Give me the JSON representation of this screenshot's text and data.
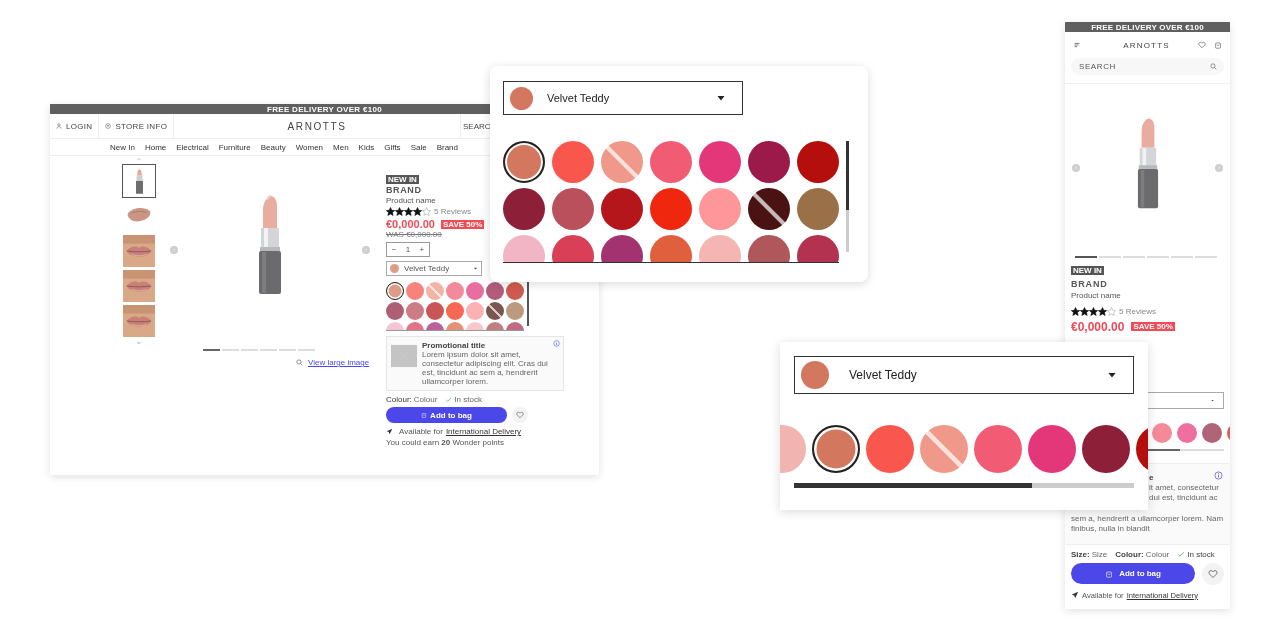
{
  "desktop": {
    "banner": "FREE DELIVERY OVER €100",
    "header": {
      "login": "LOGIN",
      "store_info": "STORE INFO",
      "logo": "ARNOTTS",
      "search": "SEARC"
    },
    "nav": [
      "New In",
      "Home",
      "Electrical",
      "Furniture",
      "Beauty",
      "Women",
      "Men",
      "Kids",
      "Gifts",
      "Sale",
      "Brand"
    ],
    "thumbnails": [
      {
        "kind": "product",
        "selected": true
      },
      {
        "kind": "smear",
        "selected": false
      },
      {
        "kind": "lips",
        "selected": false
      },
      {
        "kind": "lips",
        "selected": false
      },
      {
        "kind": "lips",
        "selected": false
      }
    ],
    "slides": [
      {
        "selected": true
      },
      {
        "selected": false
      },
      {
        "selected": false
      },
      {
        "selected": false
      },
      {
        "selected": false
      },
      {
        "selected": false
      }
    ],
    "view_large_image": "View large image",
    "product": {
      "tag": "NEW IN",
      "brand": "BRAND",
      "name": "Product name",
      "stars": 4,
      "reviews": "5 Reviews",
      "price": "€0,000.00",
      "save_badge": "SAVE 50%",
      "was_price": "WAS €0,000.00",
      "quantity": {
        "minus": "−",
        "value": "1",
        "plus": "+"
      },
      "shade_select": {
        "value": "Velvet Teddy",
        "color": "#dd9c88"
      },
      "swatches": [
        {
          "color": "#dd9c88",
          "kind": "solid",
          "selected": true
        },
        {
          "color": "#f8837a",
          "kind": "solid",
          "selected": false
        },
        {
          "color": "#f3b4a5",
          "kind": "split",
          "selected": false
        },
        {
          "color": "#f3899a",
          "kind": "solid",
          "selected": false
        },
        {
          "color": "#e96ea0",
          "kind": "solid",
          "selected": false
        },
        {
          "color": "#b15c7d",
          "kind": "solid",
          "selected": false
        },
        {
          "color": "#ce5a50",
          "kind": "solid",
          "selected": false
        },
        {
          "color": "#ad5f74",
          "kind": "solid",
          "selected": false
        },
        {
          "color": "#cd7c85",
          "kind": "solid",
          "selected": false
        },
        {
          "color": "#c95656",
          "kind": "solid",
          "selected": false
        },
        {
          "color": "#f76852",
          "kind": "solid",
          "selected": false
        },
        {
          "color": "#fcb2b3",
          "kind": "solid",
          "selected": false
        },
        {
          "color": "#7b564f",
          "kind": "split",
          "selected": false
        },
        {
          "color": "#bb9a80",
          "kind": "solid",
          "selected": false
        },
        {
          "color": "#f4c4d2",
          "kind": "solid",
          "selected": false
        },
        {
          "color": "#e07386",
          "kind": "solid",
          "selected": false
        },
        {
          "color": "#b96298",
          "kind": "solid",
          "selected": false
        },
        {
          "color": "#e69176",
          "kind": "solid",
          "selected": false
        },
        {
          "color": "#f8c7c9",
          "kind": "solid",
          "selected": false
        },
        {
          "color": "#c08080",
          "kind": "solid",
          "selected": false
        },
        {
          "color": "#c06b83",
          "kind": "solid",
          "selected": false
        }
      ],
      "promo": {
        "title": "Promotional title",
        "text": "Lorem ipsum dolor sit amet, consectetur adipiscing elit. Cras dui est, tincidunt ac sem a, hendrerit ullamcorper lorem."
      },
      "colour_label": "Colour:",
      "colour_value": "Colour",
      "stock": "In stock",
      "add_to_bag": "Add to bag",
      "delivery_prefix": "Available for",
      "delivery_link": "International Delivery",
      "points": "You could earn **20** Wonder points"
    }
  },
  "popup": {
    "shade_select": {
      "value": "Velvet Teddy",
      "color": "#d4775f"
    },
    "swatches": [
      {
        "color": "#d4775f",
        "kind": "solid",
        "selected": true
      },
      {
        "color": "#f9574e",
        "kind": "solid",
        "selected": false
      },
      {
        "color": "#f0998a",
        "kind": "split",
        "selected": false
      },
      {
        "color": "#f25b74",
        "kind": "solid",
        "selected": false
      },
      {
        "color": "#e3377a",
        "kind": "solid",
        "selected": false
      },
      {
        "color": "#9b1a4a",
        "kind": "solid",
        "selected": false
      },
      {
        "color": "#b40f0c",
        "kind": "solid",
        "selected": false
      },
      {
        "color": "#8e1f38",
        "kind": "solid",
        "selected": false
      },
      {
        "color": "#b9505c",
        "kind": "solid",
        "selected": false
      },
      {
        "color": "#b5161c",
        "kind": "solid",
        "selected": false
      },
      {
        "color": "#f0270f",
        "kind": "solid",
        "selected": false
      },
      {
        "color": "#fe979a",
        "kind": "solid",
        "selected": false
      },
      {
        "color": "#4a1212",
        "kind": "split",
        "selected": false
      },
      {
        "color": "#9a7048",
        "kind": "solid",
        "selected": false
      },
      {
        "color": "#f2b5c6",
        "kind": "solid",
        "selected": false
      },
      {
        "color": "#d93f57",
        "kind": "solid",
        "selected": false
      },
      {
        "color": "#a23270",
        "kind": "solid",
        "selected": false
      },
      {
        "color": "#e0603d",
        "kind": "solid",
        "selected": false
      },
      {
        "color": "#f5b5b3",
        "kind": "solid",
        "selected": false
      },
      {
        "color": "#b0575b",
        "kind": "solid",
        "selected": false
      },
      {
        "color": "#b2324f",
        "kind": "solid",
        "selected": false
      }
    ]
  },
  "mobile": {
    "banner": "FREE DELIVERY OVER €100",
    "logo": "ARNOTTS",
    "search": {
      "placeholder": "SEARCH"
    },
    "slides": [
      {
        "selected": true
      },
      {
        "selected": false
      },
      {
        "selected": false
      },
      {
        "selected": false
      },
      {
        "selected": false
      },
      {
        "selected": false
      }
    ],
    "tag": "NEW IN",
    "brand": "BRAND",
    "name": "Product name",
    "stars": 4,
    "reviews": "5 Reviews",
    "price": "€0,000.00",
    "save_badge": "SAVE 50%",
    "swatches": [
      {
        "color": "#f48a98",
        "selected": false
      },
      {
        "color": "#ee6fa0",
        "selected": false
      },
      {
        "color": "#b06478",
        "selected": false
      },
      {
        "color": "#d0605a",
        "selected": false
      }
    ],
    "promo": {
      "title": "e",
      "lines": [
        "it amet, consectetur",
        "dui est, tincidunt ac",
        "sem a, hendrerit a ullamcorper lorem. Nam",
        "finibus, nulla in blandit"
      ]
    },
    "size_label": "Size:",
    "size_value": "Size",
    "colour_label": "Colour:",
    "colour_value": "Colour",
    "stock": "In stock",
    "add_to_bag": "Add to bag",
    "delivery_prefix": "Available for",
    "delivery_link": "International Delivery"
  },
  "strip": {
    "shade_select": {
      "value": "Velvet Teddy",
      "color": "#d4775f"
    },
    "swatches": [
      {
        "color": "#f2b4b0",
        "kind": "solid",
        "selected": false
      },
      {
        "color": "#d4775f",
        "kind": "solid",
        "selected": true
      },
      {
        "color": "#f9574e",
        "kind": "solid",
        "selected": false
      },
      {
        "color": "#f0998a",
        "kind": "split",
        "selected": false
      },
      {
        "color": "#f25b74",
        "kind": "solid",
        "selected": false
      },
      {
        "color": "#e3377a",
        "kind": "solid",
        "selected": false
      },
      {
        "color": "#8e1f38",
        "kind": "solid",
        "selected": false
      },
      {
        "color": "#b40f0c",
        "kind": "solid",
        "selected": false
      }
    ]
  }
}
